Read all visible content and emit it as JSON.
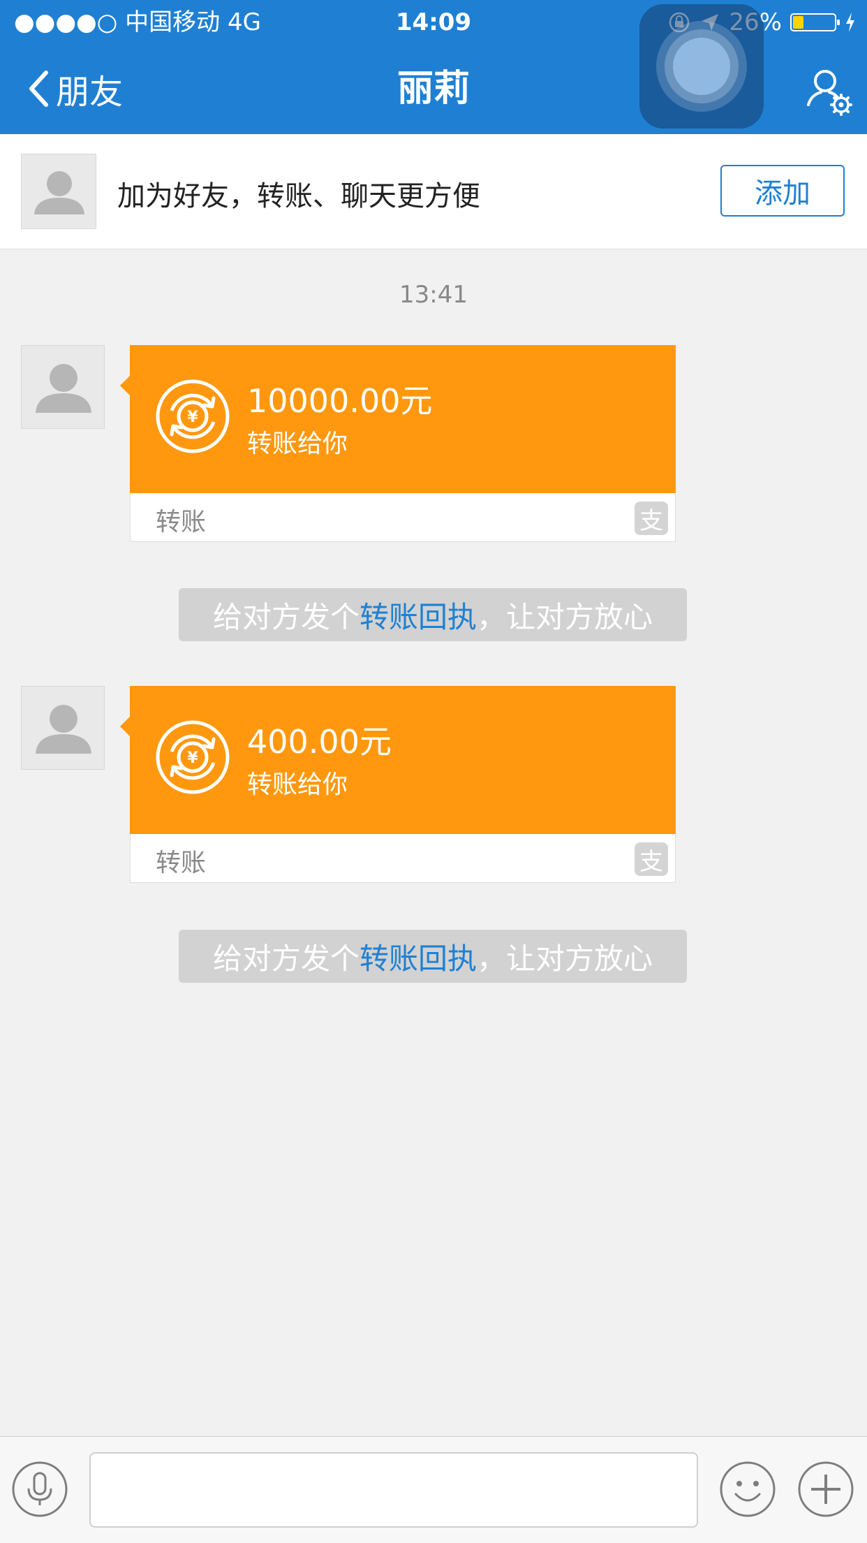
{
  "status_bar": {
    "carrier": "●●●●○ 中国移动   4G",
    "time": "14:09",
    "battery": "26%",
    "battery_level": 0.26,
    "battery_color": "#ffd400"
  },
  "nav": {
    "back_label": "朋友",
    "title": "丽莉"
  },
  "add_friend": {
    "text": "加为好友，转账、聊天更方便",
    "button_label": "添加"
  },
  "chat": {
    "timestamp": "13:41",
    "transfers": [
      {
        "amount": "10000.00元",
        "desc": "转账给你",
        "type": "转账",
        "badge": "支"
      },
      {
        "amount": "400.00元",
        "desc": "转账给你",
        "type": "转账",
        "badge": "支"
      }
    ],
    "receipt_hint": {
      "before": "给对方发个",
      "link": "转账回执",
      "after": "，让对方放心"
    }
  },
  "colors": {
    "primary": "#1f80d3",
    "transfer_orange": "#ff980f",
    "background": "#f1f1f1"
  },
  "icons": [
    "chevron-left-icon",
    "contact-settings-icon",
    "user-avatar-icon",
    "yuan-transfer-icon",
    "alipay-icon",
    "microphone-icon",
    "emoji-icon",
    "plus-icon",
    "lock-rotation-icon",
    "location-arrow-icon",
    "charging-icon",
    "assistive-touch-icon"
  ]
}
